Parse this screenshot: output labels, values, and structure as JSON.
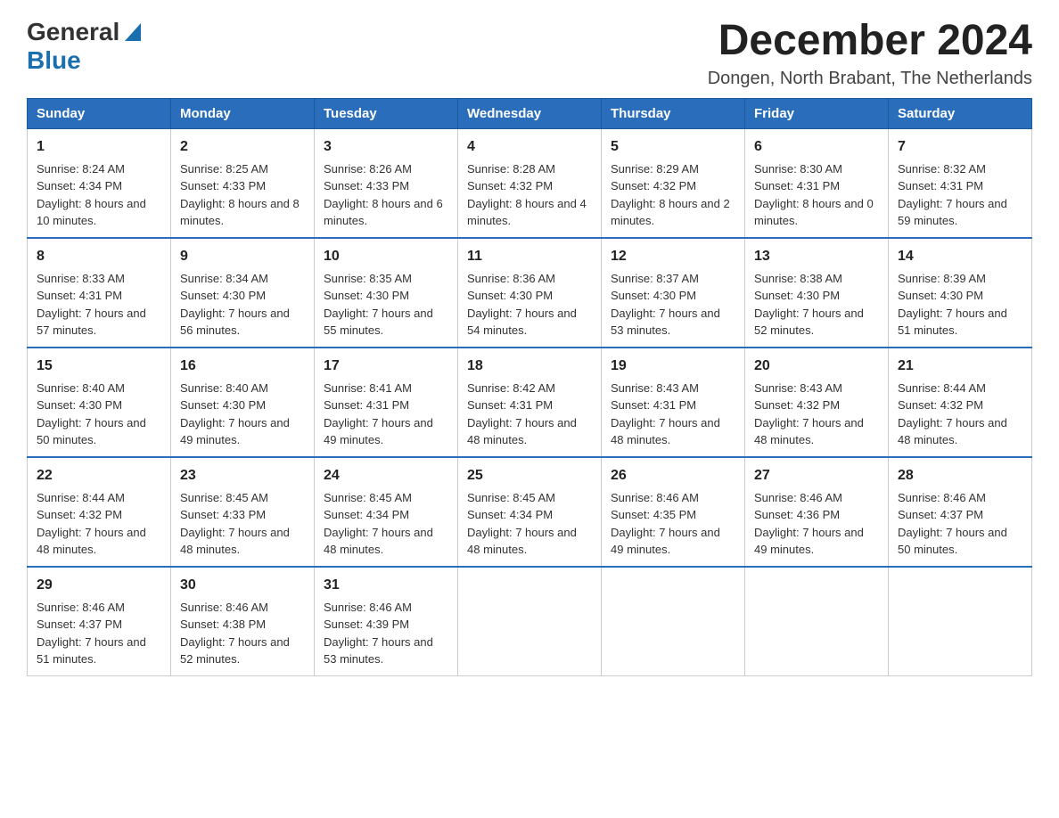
{
  "header": {
    "logo_general": "General",
    "logo_blue": "Blue",
    "month_title": "December 2024",
    "location": "Dongen, North Brabant, The Netherlands"
  },
  "weekdays": [
    "Sunday",
    "Monday",
    "Tuesday",
    "Wednesday",
    "Thursday",
    "Friday",
    "Saturday"
  ],
  "weeks": [
    [
      {
        "day": "1",
        "sunrise": "8:24 AM",
        "sunset": "4:34 PM",
        "daylight": "8 hours and 10 minutes"
      },
      {
        "day": "2",
        "sunrise": "8:25 AM",
        "sunset": "4:33 PM",
        "daylight": "8 hours and 8 minutes"
      },
      {
        "day": "3",
        "sunrise": "8:26 AM",
        "sunset": "4:33 PM",
        "daylight": "8 hours and 6 minutes"
      },
      {
        "day": "4",
        "sunrise": "8:28 AM",
        "sunset": "4:32 PM",
        "daylight": "8 hours and 4 minutes"
      },
      {
        "day": "5",
        "sunrise": "8:29 AM",
        "sunset": "4:32 PM",
        "daylight": "8 hours and 2 minutes"
      },
      {
        "day": "6",
        "sunrise": "8:30 AM",
        "sunset": "4:31 PM",
        "daylight": "8 hours and 0 minutes"
      },
      {
        "day": "7",
        "sunrise": "8:32 AM",
        "sunset": "4:31 PM",
        "daylight": "7 hours and 59 minutes"
      }
    ],
    [
      {
        "day": "8",
        "sunrise": "8:33 AM",
        "sunset": "4:31 PM",
        "daylight": "7 hours and 57 minutes"
      },
      {
        "day": "9",
        "sunrise": "8:34 AM",
        "sunset": "4:30 PM",
        "daylight": "7 hours and 56 minutes"
      },
      {
        "day": "10",
        "sunrise": "8:35 AM",
        "sunset": "4:30 PM",
        "daylight": "7 hours and 55 minutes"
      },
      {
        "day": "11",
        "sunrise": "8:36 AM",
        "sunset": "4:30 PM",
        "daylight": "7 hours and 54 minutes"
      },
      {
        "day": "12",
        "sunrise": "8:37 AM",
        "sunset": "4:30 PM",
        "daylight": "7 hours and 53 minutes"
      },
      {
        "day": "13",
        "sunrise": "8:38 AM",
        "sunset": "4:30 PM",
        "daylight": "7 hours and 52 minutes"
      },
      {
        "day": "14",
        "sunrise": "8:39 AM",
        "sunset": "4:30 PM",
        "daylight": "7 hours and 51 minutes"
      }
    ],
    [
      {
        "day": "15",
        "sunrise": "8:40 AM",
        "sunset": "4:30 PM",
        "daylight": "7 hours and 50 minutes"
      },
      {
        "day": "16",
        "sunrise": "8:40 AM",
        "sunset": "4:30 PM",
        "daylight": "7 hours and 49 minutes"
      },
      {
        "day": "17",
        "sunrise": "8:41 AM",
        "sunset": "4:31 PM",
        "daylight": "7 hours and 49 minutes"
      },
      {
        "day": "18",
        "sunrise": "8:42 AM",
        "sunset": "4:31 PM",
        "daylight": "7 hours and 48 minutes"
      },
      {
        "day": "19",
        "sunrise": "8:43 AM",
        "sunset": "4:31 PM",
        "daylight": "7 hours and 48 minutes"
      },
      {
        "day": "20",
        "sunrise": "8:43 AM",
        "sunset": "4:32 PM",
        "daylight": "7 hours and 48 minutes"
      },
      {
        "day": "21",
        "sunrise": "8:44 AM",
        "sunset": "4:32 PM",
        "daylight": "7 hours and 48 minutes"
      }
    ],
    [
      {
        "day": "22",
        "sunrise": "8:44 AM",
        "sunset": "4:32 PM",
        "daylight": "7 hours and 48 minutes"
      },
      {
        "day": "23",
        "sunrise": "8:45 AM",
        "sunset": "4:33 PM",
        "daylight": "7 hours and 48 minutes"
      },
      {
        "day": "24",
        "sunrise": "8:45 AM",
        "sunset": "4:34 PM",
        "daylight": "7 hours and 48 minutes"
      },
      {
        "day": "25",
        "sunrise": "8:45 AM",
        "sunset": "4:34 PM",
        "daylight": "7 hours and 48 minutes"
      },
      {
        "day": "26",
        "sunrise": "8:46 AM",
        "sunset": "4:35 PM",
        "daylight": "7 hours and 49 minutes"
      },
      {
        "day": "27",
        "sunrise": "8:46 AM",
        "sunset": "4:36 PM",
        "daylight": "7 hours and 49 minutes"
      },
      {
        "day": "28",
        "sunrise": "8:46 AM",
        "sunset": "4:37 PM",
        "daylight": "7 hours and 50 minutes"
      }
    ],
    [
      {
        "day": "29",
        "sunrise": "8:46 AM",
        "sunset": "4:37 PM",
        "daylight": "7 hours and 51 minutes"
      },
      {
        "day": "30",
        "sunrise": "8:46 AM",
        "sunset": "4:38 PM",
        "daylight": "7 hours and 52 minutes"
      },
      {
        "day": "31",
        "sunrise": "8:46 AM",
        "sunset": "4:39 PM",
        "daylight": "7 hours and 53 minutes"
      },
      null,
      null,
      null,
      null
    ]
  ],
  "labels": {
    "sunrise": "Sunrise:",
    "sunset": "Sunset:",
    "daylight": "Daylight:"
  }
}
